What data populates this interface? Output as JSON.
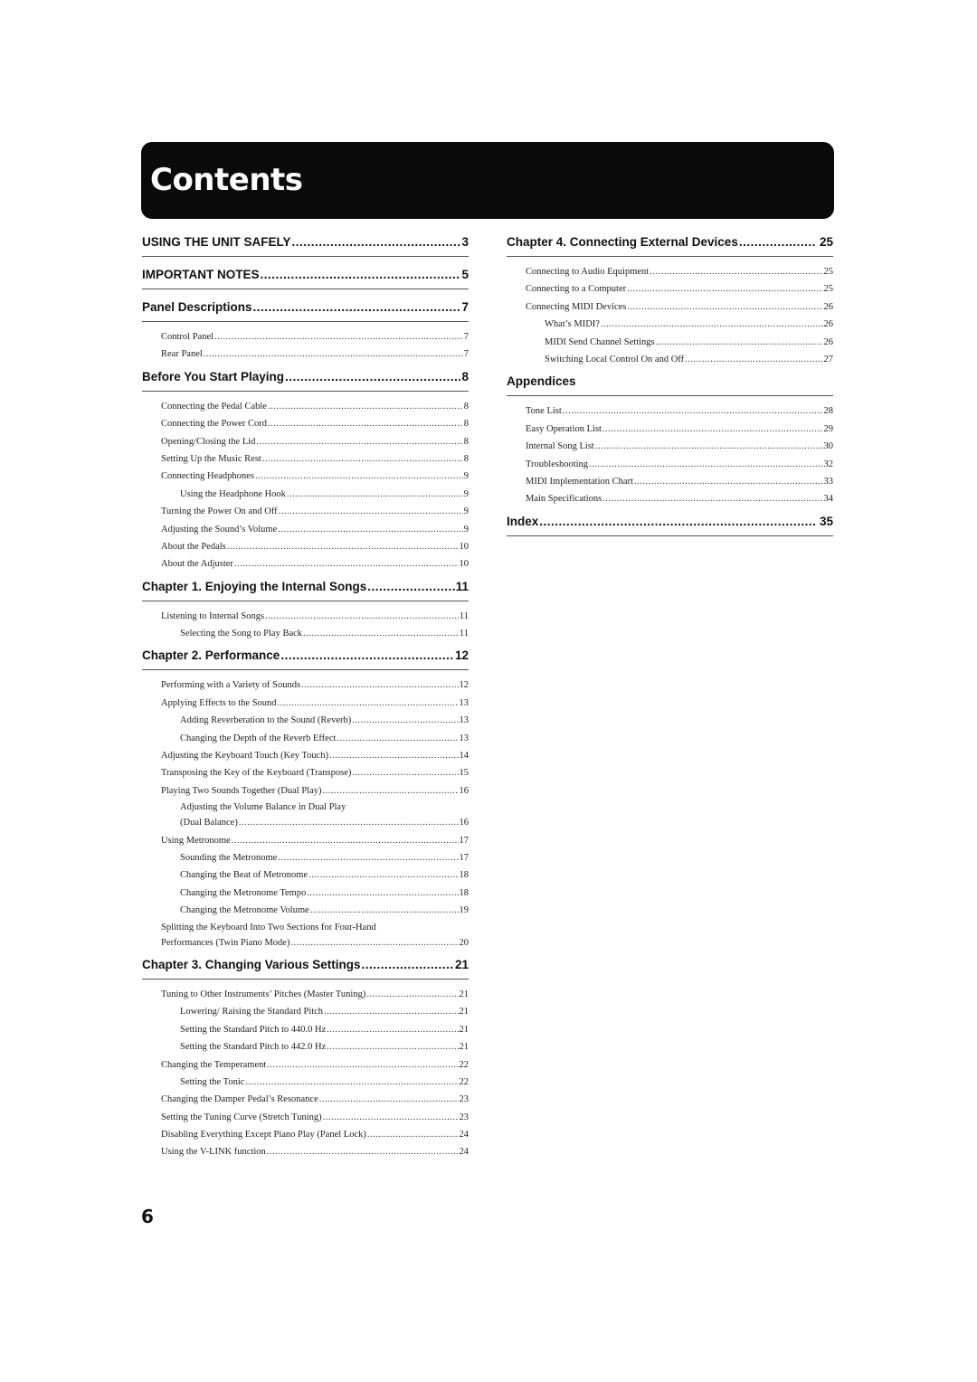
{
  "header": {
    "title": "Contents"
  },
  "page_number": "6",
  "left_column": [
    {
      "title": "USING THE UNIT SAFELY",
      "page": "3",
      "entries": []
    },
    {
      "title": "IMPORTANT NOTES",
      "page": "5",
      "entries": []
    },
    {
      "title": "Panel Descriptions",
      "page": "7",
      "entries": [
        {
          "level": 1,
          "title": "Control Panel",
          "page": "7"
        },
        {
          "level": 1,
          "title": "Rear Panel",
          "page": "7"
        }
      ]
    },
    {
      "title": "Before You Start Playing",
      "page": "8",
      "entries": [
        {
          "level": 1,
          "title": "Connecting the Pedal Cable",
          "page": "8"
        },
        {
          "level": 1,
          "title": "Connecting the Power Cord",
          "page": "8"
        },
        {
          "level": 1,
          "title": "Opening/Closing the Lid",
          "page": "8"
        },
        {
          "level": 1,
          "title": "Setting Up the Music Rest",
          "page": "8"
        },
        {
          "level": 1,
          "title": "Connecting Headphones",
          "page": "9"
        },
        {
          "level": 2,
          "title": "Using the Headphone Hook",
          "page": "9"
        },
        {
          "level": 1,
          "title": "Turning the Power On and Off",
          "page": "9"
        },
        {
          "level": 1,
          "title": "Adjusting the Sound’s Volume",
          "page": "9"
        },
        {
          "level": 1,
          "title": "About the Pedals",
          "page": "10"
        },
        {
          "level": 1,
          "title": "About the Adjuster",
          "page": "10"
        }
      ]
    },
    {
      "title": "Chapter 1. Enjoying the Internal Songs",
      "page": "11",
      "entries": [
        {
          "level": 1,
          "title": "Listening to Internal Songs",
          "page": "11"
        },
        {
          "level": 2,
          "title": "Selecting the Song to Play Back",
          "page": "11"
        }
      ]
    },
    {
      "title": "Chapter 2. Performance",
      "page": "12",
      "entries": [
        {
          "level": 1,
          "title": "Performing with a Variety of Sounds",
          "page": "12"
        },
        {
          "level": 1,
          "title": "Applying Effects to the Sound",
          "page": "13"
        },
        {
          "level": 2,
          "title": "Adding Reverberation to the Sound (Reverb)",
          "page": "13"
        },
        {
          "level": 2,
          "title": "Changing the Depth of the Reverb Effect",
          "page": "13"
        },
        {
          "level": 1,
          "title": "Adjusting the Keyboard Touch (Key Touch)",
          "page": "14"
        },
        {
          "level": 1,
          "title": "Transposing the Key of the Keyboard (Transpose)",
          "page": "15"
        },
        {
          "level": 1,
          "title": "Playing Two Sounds Together (Dual Play)",
          "page": "16"
        },
        {
          "level": 2,
          "title": "Adjusting the Volume Balance in Dual Play",
          "title2": "(Dual Balance)",
          "page": "16"
        },
        {
          "level": 1,
          "title": "Using Metronome",
          "page": "17"
        },
        {
          "level": 2,
          "title": "Sounding the Metronome",
          "page": "17"
        },
        {
          "level": 2,
          "title": "Changing the Beat of Metronome",
          "page": "18"
        },
        {
          "level": 2,
          "title": "Changing the Metronome Tempo",
          "page": "18"
        },
        {
          "level": 2,
          "title": "Changing the Metronome Volume",
          "page": "19"
        },
        {
          "level": 1,
          "title": "Splitting the Keyboard Into Two Sections for Four-Hand",
          "title2": "Performances (Twin Piano Mode)",
          "page": "20"
        }
      ]
    },
    {
      "title": "Chapter 3. Changing Various Settings",
      "page": "21",
      "entries": [
        {
          "level": 1,
          "title": "Tuning to Other Instruments’ Pitches (Master Tuning)",
          "page": "21"
        },
        {
          "level": 2,
          "title": "Lowering/ Raising the Standard Pitch",
          "page": "21"
        },
        {
          "level": 2,
          "title": "Setting the Standard Pitch to 440.0 Hz",
          "page": "21"
        },
        {
          "level": 2,
          "title": "Setting the Standard Pitch to 442.0 Hz",
          "page": "21"
        },
        {
          "level": 1,
          "title": "Changing the Temperament",
          "page": "22"
        },
        {
          "level": 2,
          "title": "Setting the Tonic",
          "page": "22"
        },
        {
          "level": 1,
          "title": "Changing the Damper Pedal’s Resonance",
          "page": "23"
        },
        {
          "level": 1,
          "title": "Setting the Tuning Curve (Stretch Tuning)",
          "page": "23"
        },
        {
          "level": 1,
          "title": "Disabling Everything Except Piano Play (Panel Lock)",
          "page": "24"
        },
        {
          "level": 1,
          "title": "Using the V-LINK function",
          "page": "24"
        }
      ]
    }
  ],
  "right_column": [
    {
      "title": "Chapter 4. Connecting External Devices",
      "page": "25",
      "entries": [
        {
          "level": 1,
          "title": "Connecting to Audio Equipment",
          "page": "25"
        },
        {
          "level": 1,
          "title": "Connecting to a Computer",
          "page": "25"
        },
        {
          "level": 1,
          "title": "Connecting MIDI Devices",
          "page": "26"
        },
        {
          "level": 2,
          "title": "What’s MIDI?",
          "page": "26"
        },
        {
          "level": 2,
          "title": "MIDI Send Channel Settings",
          "page": "26"
        },
        {
          "level": 2,
          "title": "Switching Local Control On and Off",
          "page": "27"
        }
      ]
    },
    {
      "title": "Appendices",
      "page": "",
      "entries": [
        {
          "level": 1,
          "title": "Tone List",
          "page": "28"
        },
        {
          "level": 1,
          "title": "Easy Operation List",
          "page": "29"
        },
        {
          "level": 1,
          "title": "Internal Song List",
          "page": "30"
        },
        {
          "level": 1,
          "title": "Troubleshooting",
          "page": "32"
        },
        {
          "level": 1,
          "title": "MIDI Implementation Chart",
          "page": "33"
        },
        {
          "level": 1,
          "title": "Main Specifications",
          "page": "34"
        }
      ]
    },
    {
      "title": "Index",
      "page": "35",
      "entries": []
    }
  ]
}
